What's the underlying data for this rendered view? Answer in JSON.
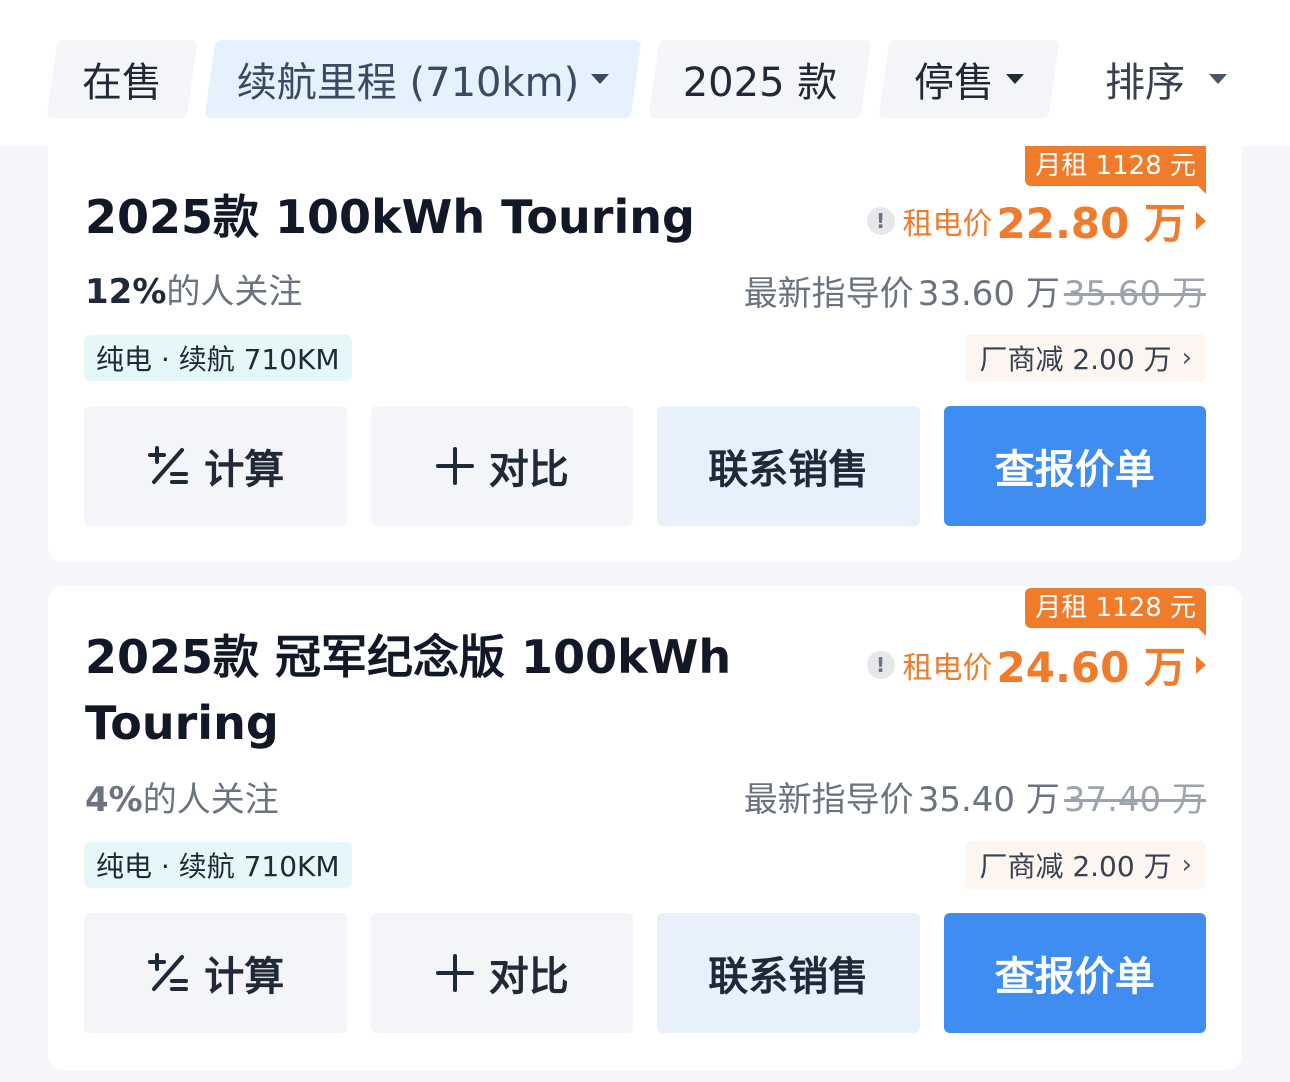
{
  "filters": {
    "on_sale": "在售",
    "range": "续航里程 (710km)",
    "year": "2025 款",
    "stopped": "停售",
    "sort": "排序"
  },
  "cars": [
    {
      "title": "2025款 100kWh Touring",
      "attention_pct": "12%",
      "attention_text": "的人关注",
      "tag": "纯电 · 续航 710KM",
      "rent_badge": "月租 1128 元",
      "rent_label": "租电价",
      "rent_price": "22.80 万",
      "guide_label": "最新指导价",
      "guide_price": "33.60 万",
      "guide_old": "35.60 万",
      "discount": "厂商减 2.00 万",
      "discount_chevron": "›"
    },
    {
      "title": "2025款 冠军纪念版 100kWh Touring",
      "attention_pct": "4%",
      "attention_text": "的人关注",
      "tag": "纯电 · 续航 710KM",
      "rent_badge": "月租 1128 元",
      "rent_label": "租电价",
      "rent_price": "24.60 万",
      "guide_label": "最新指导价",
      "guide_price": "35.40 万",
      "guide_old": "37.40 万",
      "discount": "厂商减 2.00 万",
      "discount_chevron": "›"
    }
  ],
  "buttons": {
    "calc": "计算",
    "compare": "对比",
    "contact": "联系销售",
    "quote": "查报价单"
  },
  "colors": {
    "accent_orange": "#f07b2b",
    "primary_blue": "#3f8df0",
    "contact_bg": "#e6f1fc",
    "tag_bg": "#e6f7fa"
  },
  "icons": {
    "calc": "plus-minus-icon",
    "compare": "plus-icon",
    "info": "info-icon",
    "caret": "caret-down-icon"
  }
}
